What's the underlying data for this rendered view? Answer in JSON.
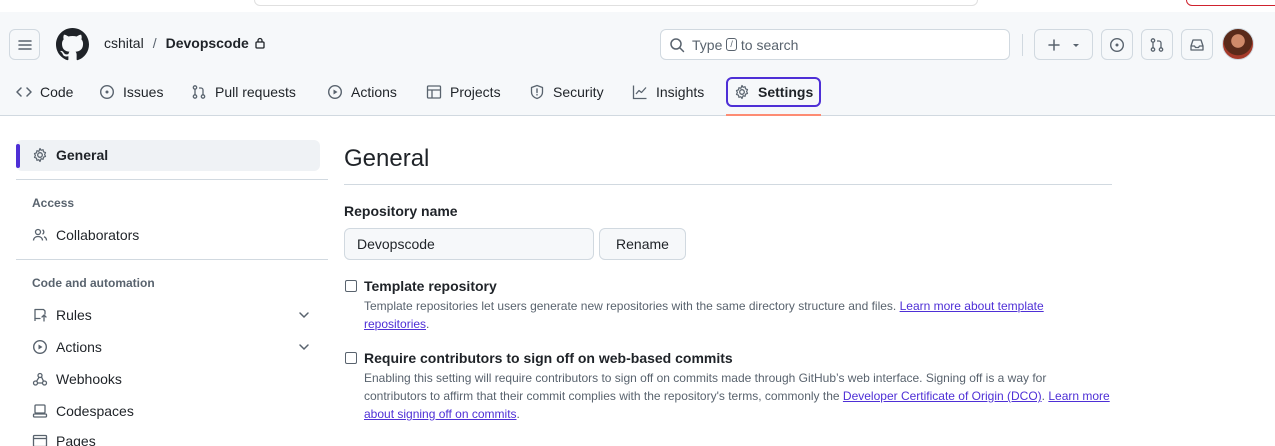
{
  "header": {
    "owner": "cshital",
    "separator": "/",
    "repo": "Devopscode",
    "search": {
      "prefix": "Type",
      "key": "/",
      "suffix": "to search"
    }
  },
  "tabs": [
    {
      "label": "Code",
      "icon": "code-icon"
    },
    {
      "label": "Issues",
      "icon": "issue-icon"
    },
    {
      "label": "Pull requests",
      "icon": "pull-request-icon"
    },
    {
      "label": "Actions",
      "icon": "play-icon"
    },
    {
      "label": "Projects",
      "icon": "table-icon"
    },
    {
      "label": "Security",
      "icon": "shield-icon"
    },
    {
      "label": "Insights",
      "icon": "graph-icon"
    },
    {
      "label": "Settings",
      "icon": "gear-icon",
      "selected": true
    }
  ],
  "sidebar": {
    "general": "General",
    "access_heading": "Access",
    "collaborators": "Collaborators",
    "code_automation_heading": "Code and automation",
    "rules": "Rules",
    "actions": "Actions",
    "webhooks": "Webhooks",
    "codespaces": "Codespaces",
    "pages": "Pages"
  },
  "main": {
    "title": "General",
    "repo_name_label": "Repository name",
    "repo_name_value": "Devopscode",
    "rename_button": "Rename",
    "template": {
      "title": "Template repository",
      "desc": "Template repositories let users generate new repositories with the same directory structure and files.",
      "link": "Learn more about template repositories",
      "end": "."
    },
    "signoff": {
      "title": "Require contributors to sign off on web-based commits",
      "desc": "Enabling this setting will require contributors to sign off on commits made through GitHub’s web interface. Signing off is a way for contributors to affirm that their commit complies with the repository's terms, commonly the",
      "link1": "Developer Certificate of Origin (DCO)",
      "mid": ".",
      "link2": "Learn more about signing off on commits",
      "end": "."
    }
  },
  "colors": {
    "accent": "#4e2fd6",
    "underline": "#fd8c73",
    "muted": "#59636e"
  }
}
